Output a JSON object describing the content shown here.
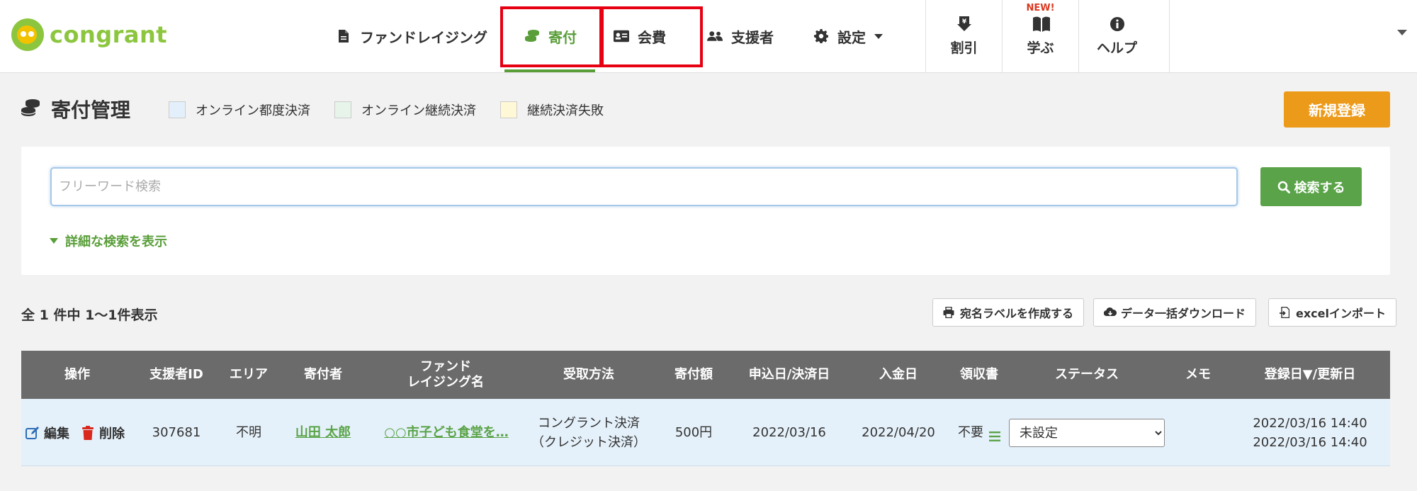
{
  "brand": {
    "name": "congrant"
  },
  "nav": {
    "fundraising": "ファンドレイジング",
    "donation": "寄付",
    "membership": "会費",
    "supporters": "支援者",
    "settings": "設定",
    "discount": "割引",
    "learn": "学ぶ",
    "learn_badge": "NEW!",
    "help": "ヘルプ"
  },
  "page": {
    "title": "寄付管理",
    "legend": [
      "オンライン都度決済",
      "オンライン継続決済",
      "継続決済失敗"
    ],
    "legend_colors": [
      "#e3f0fb",
      "#e6f4ea",
      "#fff8d6"
    ],
    "new_button": "新規登録"
  },
  "search": {
    "placeholder": "フリーワード検索",
    "button": "検索する",
    "detail_toggle": "詳細な検索を表示"
  },
  "results": {
    "count_text": "全 1 件中 1〜1件表示",
    "tools": [
      "宛名ラベルを作成する",
      "データ一括ダウンロード",
      "excelインポート"
    ]
  },
  "table": {
    "headers": [
      "操作",
      "支援者ID",
      "エリア",
      "寄付者",
      "ファンド\nレイジング名",
      "受取方法",
      "寄付額",
      "申込日/決済日",
      "入金日",
      "領収書",
      "ステータス",
      "メモ",
      "登録日▼/更新日"
    ],
    "rows": [
      {
        "edit": "編集",
        "delete": "削除",
        "supporter_id": "307681",
        "area": "不明",
        "donor": "山田 太郎",
        "fundraising": "○○市子ども食堂を…",
        "method_line1": "コングラント決済",
        "method_line2": "（クレジット決済）",
        "amount": "500円",
        "applied_date": "2022/03/16",
        "paid_date": "2022/04/20",
        "receipt": "不要",
        "status": "未設定",
        "memo": "",
        "registered": "2022/03/16 14:40",
        "updated": "2022/03/16 14:40"
      }
    ]
  },
  "accent_colors": {
    "green": "#5aa348",
    "orange": "#ec9a1a",
    "highlight": "#e60012"
  }
}
